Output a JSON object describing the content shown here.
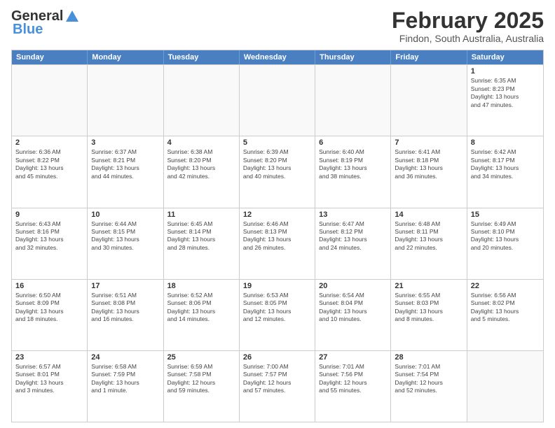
{
  "header": {
    "logo_general": "General",
    "logo_blue": "Blue",
    "month": "February 2025",
    "location": "Findon, South Australia, Australia"
  },
  "days_of_week": [
    "Sunday",
    "Monday",
    "Tuesday",
    "Wednesday",
    "Thursday",
    "Friday",
    "Saturday"
  ],
  "weeks": [
    [
      {
        "day": "",
        "info": ""
      },
      {
        "day": "",
        "info": ""
      },
      {
        "day": "",
        "info": ""
      },
      {
        "day": "",
        "info": ""
      },
      {
        "day": "",
        "info": ""
      },
      {
        "day": "",
        "info": ""
      },
      {
        "day": "1",
        "info": "Sunrise: 6:35 AM\nSunset: 8:23 PM\nDaylight: 13 hours\nand 47 minutes."
      }
    ],
    [
      {
        "day": "2",
        "info": "Sunrise: 6:36 AM\nSunset: 8:22 PM\nDaylight: 13 hours\nand 45 minutes."
      },
      {
        "day": "3",
        "info": "Sunrise: 6:37 AM\nSunset: 8:21 PM\nDaylight: 13 hours\nand 44 minutes."
      },
      {
        "day": "4",
        "info": "Sunrise: 6:38 AM\nSunset: 8:20 PM\nDaylight: 13 hours\nand 42 minutes."
      },
      {
        "day": "5",
        "info": "Sunrise: 6:39 AM\nSunset: 8:20 PM\nDaylight: 13 hours\nand 40 minutes."
      },
      {
        "day": "6",
        "info": "Sunrise: 6:40 AM\nSunset: 8:19 PM\nDaylight: 13 hours\nand 38 minutes."
      },
      {
        "day": "7",
        "info": "Sunrise: 6:41 AM\nSunset: 8:18 PM\nDaylight: 13 hours\nand 36 minutes."
      },
      {
        "day": "8",
        "info": "Sunrise: 6:42 AM\nSunset: 8:17 PM\nDaylight: 13 hours\nand 34 minutes."
      }
    ],
    [
      {
        "day": "9",
        "info": "Sunrise: 6:43 AM\nSunset: 8:16 PM\nDaylight: 13 hours\nand 32 minutes."
      },
      {
        "day": "10",
        "info": "Sunrise: 6:44 AM\nSunset: 8:15 PM\nDaylight: 13 hours\nand 30 minutes."
      },
      {
        "day": "11",
        "info": "Sunrise: 6:45 AM\nSunset: 8:14 PM\nDaylight: 13 hours\nand 28 minutes."
      },
      {
        "day": "12",
        "info": "Sunrise: 6:46 AM\nSunset: 8:13 PM\nDaylight: 13 hours\nand 26 minutes."
      },
      {
        "day": "13",
        "info": "Sunrise: 6:47 AM\nSunset: 8:12 PM\nDaylight: 13 hours\nand 24 minutes."
      },
      {
        "day": "14",
        "info": "Sunrise: 6:48 AM\nSunset: 8:11 PM\nDaylight: 13 hours\nand 22 minutes."
      },
      {
        "day": "15",
        "info": "Sunrise: 6:49 AM\nSunset: 8:10 PM\nDaylight: 13 hours\nand 20 minutes."
      }
    ],
    [
      {
        "day": "16",
        "info": "Sunrise: 6:50 AM\nSunset: 8:09 PM\nDaylight: 13 hours\nand 18 minutes."
      },
      {
        "day": "17",
        "info": "Sunrise: 6:51 AM\nSunset: 8:08 PM\nDaylight: 13 hours\nand 16 minutes."
      },
      {
        "day": "18",
        "info": "Sunrise: 6:52 AM\nSunset: 8:06 PM\nDaylight: 13 hours\nand 14 minutes."
      },
      {
        "day": "19",
        "info": "Sunrise: 6:53 AM\nSunset: 8:05 PM\nDaylight: 13 hours\nand 12 minutes."
      },
      {
        "day": "20",
        "info": "Sunrise: 6:54 AM\nSunset: 8:04 PM\nDaylight: 13 hours\nand 10 minutes."
      },
      {
        "day": "21",
        "info": "Sunrise: 6:55 AM\nSunset: 8:03 PM\nDaylight: 13 hours\nand 8 minutes."
      },
      {
        "day": "22",
        "info": "Sunrise: 6:56 AM\nSunset: 8:02 PM\nDaylight: 13 hours\nand 5 minutes."
      }
    ],
    [
      {
        "day": "23",
        "info": "Sunrise: 6:57 AM\nSunset: 8:01 PM\nDaylight: 13 hours\nand 3 minutes."
      },
      {
        "day": "24",
        "info": "Sunrise: 6:58 AM\nSunset: 7:59 PM\nDaylight: 13 hours\nand 1 minute."
      },
      {
        "day": "25",
        "info": "Sunrise: 6:59 AM\nSunset: 7:58 PM\nDaylight: 12 hours\nand 59 minutes."
      },
      {
        "day": "26",
        "info": "Sunrise: 7:00 AM\nSunset: 7:57 PM\nDaylight: 12 hours\nand 57 minutes."
      },
      {
        "day": "27",
        "info": "Sunrise: 7:01 AM\nSunset: 7:56 PM\nDaylight: 12 hours\nand 55 minutes."
      },
      {
        "day": "28",
        "info": "Sunrise: 7:01 AM\nSunset: 7:54 PM\nDaylight: 12 hours\nand 52 minutes."
      },
      {
        "day": "",
        "info": ""
      }
    ]
  ]
}
